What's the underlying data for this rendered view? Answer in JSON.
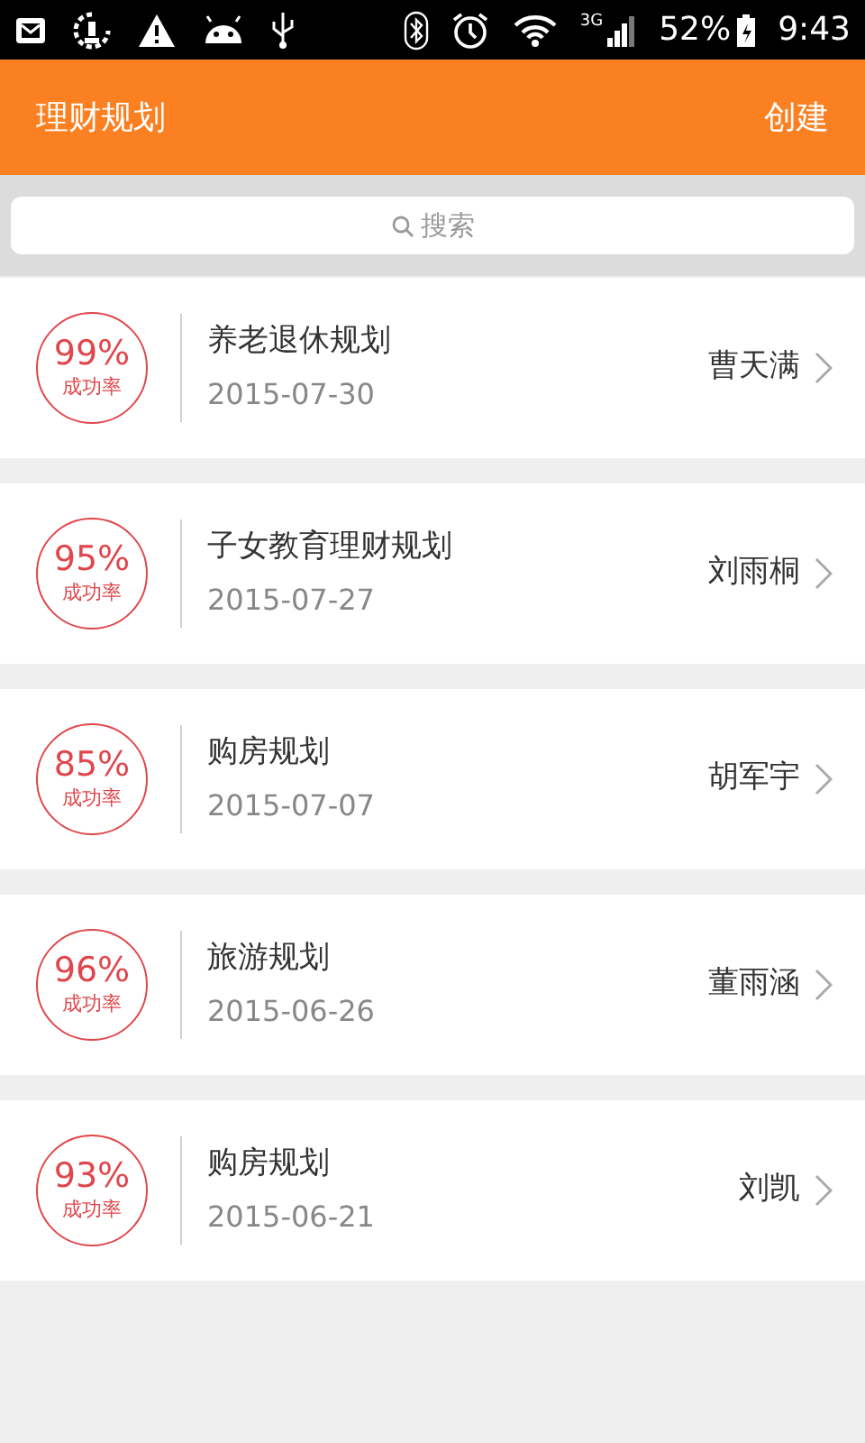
{
  "status_bar": {
    "network": "3G",
    "battery": "52%",
    "time": "9:43"
  },
  "header": {
    "title": "理财规划",
    "action": "创建"
  },
  "search": {
    "placeholder": "搜索"
  },
  "plans": [
    {
      "rate": "99%",
      "rate_label": "成功率",
      "title": "养老退休规划",
      "date": "2015-07-30",
      "client": "曹天满"
    },
    {
      "rate": "95%",
      "rate_label": "成功率",
      "title": "子女教育理财规划",
      "date": "2015-07-27",
      "client": "刘雨桐"
    },
    {
      "rate": "85%",
      "rate_label": "成功率",
      "title": "购房规划",
      "date": "2015-07-07",
      "client": "胡军宇"
    },
    {
      "rate": "96%",
      "rate_label": "成功率",
      "title": "旅游规划",
      "date": "2015-06-26",
      "client": "董雨涵"
    },
    {
      "rate": "93%",
      "rate_label": "成功率",
      "title": "购房规划",
      "date": "2015-06-21",
      "client": "刘凯"
    }
  ]
}
